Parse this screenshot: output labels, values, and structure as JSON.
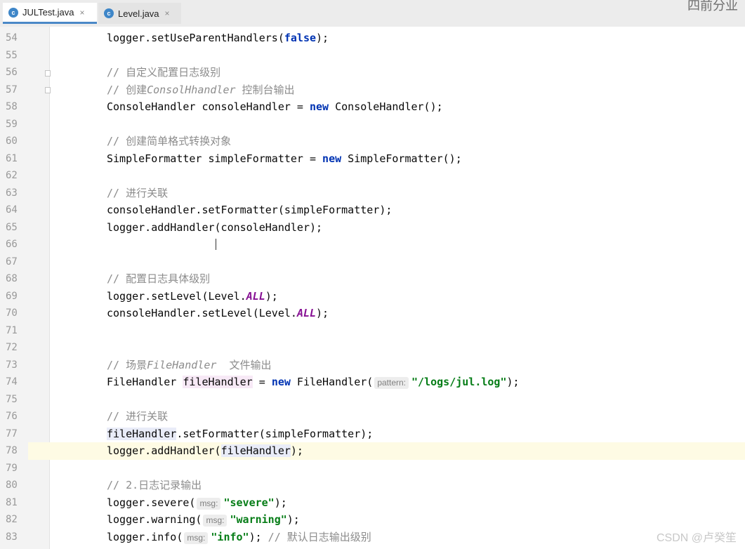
{
  "tabs": [
    {
      "label": "JULTest.java",
      "active": true
    },
    {
      "label": "Level.java",
      "active": false
    }
  ],
  "tab_icon_glyph": "c",
  "close_glyph": "×",
  "corner_text": "四前分业",
  "watermark": "CSDN @卢癸笙",
  "hints": {
    "pattern": "pattern:",
    "msg": "msg:"
  },
  "lines": [
    {
      "n": "54",
      "code": [
        "logger.setUseParentHandlers(",
        {
          "kw": "false"
        },
        ");"
      ]
    },
    {
      "n": "55",
      "code": []
    },
    {
      "n": "56",
      "code": [
        {
          "cmt": "// 自定义配置日志级别"
        }
      ]
    },
    {
      "n": "57",
      "code": [
        {
          "cmt": "// 创建"
        },
        {
          "cmtit": "ConsolHhandler"
        },
        {
          "cmt": " 控制台输出"
        }
      ]
    },
    {
      "n": "58",
      "code": [
        "ConsoleHandler consoleHandler = ",
        {
          "kw": "new"
        },
        " ConsoleHandler();"
      ]
    },
    {
      "n": "59",
      "code": []
    },
    {
      "n": "60",
      "code": [
        {
          "cmt": "// 创建简单格式转换对象"
        }
      ]
    },
    {
      "n": "61",
      "code": [
        "SimpleFormatter simpleFormatter = ",
        {
          "kw": "new"
        },
        " SimpleFormatter();"
      ]
    },
    {
      "n": "62",
      "code": []
    },
    {
      "n": "63",
      "code": [
        {
          "cmt": "// 进行关联"
        }
      ]
    },
    {
      "n": "64",
      "code": [
        "consoleHandler.setFormatter(simpleFormatter);"
      ]
    },
    {
      "n": "65",
      "code": [
        "logger.addHandler(consoleHandler);"
      ]
    },
    {
      "n": "66",
      "code": []
    },
    {
      "n": "67",
      "code": []
    },
    {
      "n": "68",
      "code": [
        {
          "cmt": "// 配置日志具体级别"
        }
      ]
    },
    {
      "n": "69",
      "code": [
        "logger.setLevel(Level.",
        {
          "it": "ALL"
        },
        ");"
      ]
    },
    {
      "n": "70",
      "code": [
        "consoleHandler.setLevel(Level.",
        {
          "it": "ALL"
        },
        ");"
      ]
    },
    {
      "n": "71",
      "code": []
    },
    {
      "n": "72",
      "code": []
    },
    {
      "n": "73",
      "code": [
        {
          "cmt": "// 场景"
        },
        {
          "cmtit": "FileHandler"
        },
        {
          "cmt": "  文件输出"
        }
      ]
    },
    {
      "n": "74",
      "code": [
        "FileHandler ",
        {
          "varhl": "fileHandler"
        },
        " = ",
        {
          "kw": "new"
        },
        " FileHandler(",
        {
          "hint": "pattern"
        },
        {
          "str": "\"/logs/jul.log\""
        },
        ");"
      ]
    },
    {
      "n": "75",
      "code": []
    },
    {
      "n": "76",
      "code": [
        {
          "cmt": "// 进行关联"
        }
      ]
    },
    {
      "n": "77",
      "code": [
        {
          "usage": "fileHandler"
        },
        ".setFormatter(simpleFormatter);"
      ]
    },
    {
      "n": "78",
      "current": true,
      "code": [
        "logger.addHandler(",
        {
          "usage": "fileHandler"
        },
        ");"
      ]
    },
    {
      "n": "79",
      "code": []
    },
    {
      "n": "80",
      "code": [
        {
          "cmt": "// 2.日志记录输出"
        }
      ]
    },
    {
      "n": "81",
      "code": [
        "logger.severe(",
        {
          "hint": "msg"
        },
        {
          "str": "\"severe\""
        },
        ");"
      ]
    },
    {
      "n": "82",
      "code": [
        "logger.warning(",
        {
          "hint": "msg"
        },
        {
          "str": "\"warning\""
        },
        ");"
      ]
    },
    {
      "n": "83",
      "code": [
        "logger.info(",
        {
          "hint": "msg"
        },
        {
          "str": "\"info\""
        },
        "); ",
        {
          "cmt": "// 默认日志输出级别"
        }
      ]
    }
  ]
}
